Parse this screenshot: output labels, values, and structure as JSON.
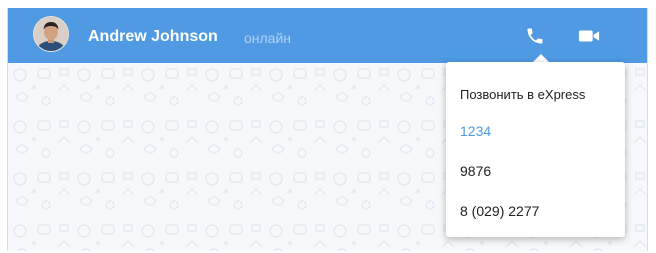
{
  "header": {
    "contact_name": "Andrew Johnson",
    "status": "онлайн",
    "call_icon": "phone-icon",
    "video_icon": "video-camera-icon"
  },
  "call_menu": {
    "title": "Позвонить в eXpress",
    "options": [
      {
        "label": "1234",
        "highlighted": true
      },
      {
        "label": "9876",
        "highlighted": false
      },
      {
        "label": "8 (029) 2277",
        "highlighted": false
      }
    ]
  },
  "colors": {
    "header_bg": "#4f9ae3",
    "accent": "#4f9ae3",
    "status_text": "#b5d3f3",
    "chat_bg": "#f6f8fb"
  }
}
